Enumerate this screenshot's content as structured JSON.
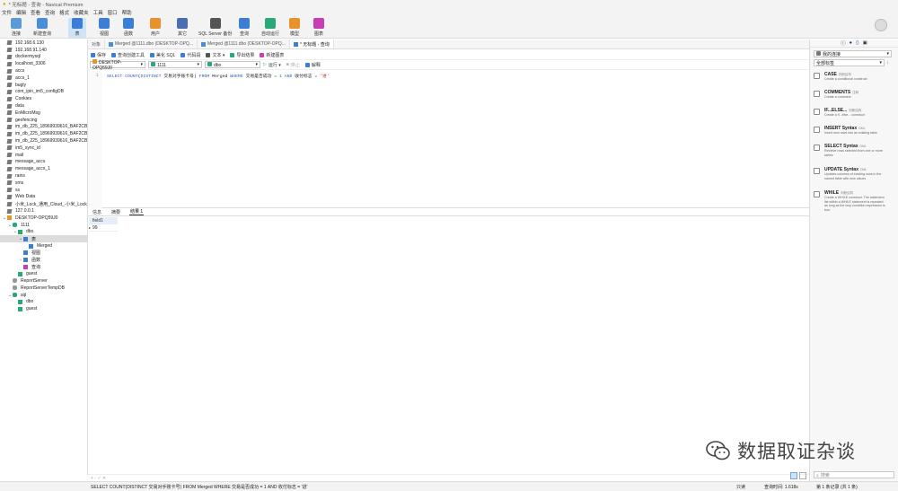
{
  "window": {
    "title": "* 无标题 - 查询 - Navicat Premium"
  },
  "menu": [
    "文件",
    "编辑",
    "查看",
    "查询",
    "格式",
    "收藏夹",
    "工具",
    "窗口",
    "帮助"
  ],
  "toolbar": [
    {
      "label": "连接",
      "icon": "connection-icon",
      "color": "#5b9bd5"
    },
    {
      "label": "新建查询",
      "icon": "new-query-icon",
      "color": "#4a8ed8"
    },
    {
      "label": "表",
      "icon": "table-icon",
      "color": "#3a7fd5",
      "active": true
    },
    {
      "label": "视图",
      "icon": "view-icon",
      "color": "#3a7fd5"
    },
    {
      "label": "函数",
      "icon": "function-icon",
      "color": "#3a7fd5"
    },
    {
      "label": "用户",
      "icon": "user-icon",
      "color": "#e8922c"
    },
    {
      "label": "其它",
      "icon": "other-icon",
      "color": "#4a6fb0"
    },
    {
      "label": "SQL Server 备份",
      "icon": "backup-icon",
      "color": "#555555"
    },
    {
      "label": "查询",
      "icon": "query-icon",
      "color": "#3a7fd5"
    },
    {
      "label": "自动运行",
      "icon": "automation-icon",
      "color": "#2aa876"
    },
    {
      "label": "模型",
      "icon": "model-icon",
      "color": "#e8922c"
    },
    {
      "label": "图表",
      "icon": "chart-icon",
      "color": "#c83fb5"
    }
  ],
  "nav": [
    {
      "label": "192.168.6.130",
      "icon": "db",
      "level": 0
    },
    {
      "label": "192.168.91.140",
      "icon": "db",
      "level": 0
    },
    {
      "label": "dockermysql",
      "icon": "db",
      "level": 0
    },
    {
      "label": "localhost_3306",
      "icon": "db",
      "level": 0
    },
    {
      "label": "accs",
      "icon": "db",
      "level": 0
    },
    {
      "label": "accs_1",
      "icon": "db",
      "level": 0
    },
    {
      "label": "bugly",
      "icon": "db",
      "level": 0
    },
    {
      "label": "com_ipin_im5_configDB",
      "icon": "db",
      "level": 0
    },
    {
      "label": "Cookies",
      "icon": "db",
      "level": 0
    },
    {
      "label": "data",
      "icon": "db",
      "level": 0
    },
    {
      "label": "EnMicroMsg",
      "icon": "db",
      "level": 0
    },
    {
      "label": "geofencing",
      "icon": "db",
      "level": 0
    },
    {
      "label": "im_db_225_18969939616_BAF2CB1F-",
      "icon": "db",
      "level": 0
    },
    {
      "label": "im_db_225_18969939616_BAF2CB1F-",
      "icon": "db",
      "level": 0
    },
    {
      "label": "im_db_225_18969939616_BAF2CB1F-",
      "icon": "db",
      "level": 0
    },
    {
      "label": "im5_sync_id",
      "icon": "db",
      "level": 0
    },
    {
      "label": "mail",
      "icon": "db",
      "level": 0
    },
    {
      "label": "message_accs",
      "icon": "db",
      "level": 0
    },
    {
      "label": "message_accs_1",
      "icon": "db",
      "level": 0
    },
    {
      "label": "rains",
      "icon": "db",
      "level": 0
    },
    {
      "label": "sms",
      "icon": "db",
      "level": 0
    },
    {
      "label": "ss",
      "icon": "db",
      "level": 0
    },
    {
      "label": "Web Data",
      "icon": "db",
      "level": 0
    },
    {
      "label": "小米_Lock_通用_Cloud_-小米_Lock_通",
      "icon": "db",
      "level": 0
    },
    {
      "label": "127.0.0.1",
      "icon": "db",
      "level": 0
    },
    {
      "label": "DESKTOP-OPQ59J0",
      "icon": "server",
      "level": 0,
      "toggle": "v"
    },
    {
      "label": "1111",
      "icon": "database",
      "level": 1,
      "toggle": "v"
    },
    {
      "label": "dbo",
      "icon": "schema",
      "level": 2,
      "toggle": "v"
    },
    {
      "label": "表",
      "icon": "table",
      "level": 3,
      "toggle": "v",
      "selected": true
    },
    {
      "label": "Merged",
      "icon": "table",
      "level": 4
    },
    {
      "label": "视图",
      "icon": "view",
      "level": 3
    },
    {
      "label": "函数",
      "icon": "function",
      "level": 3,
      "toggle": ">"
    },
    {
      "label": "查询",
      "icon": "query",
      "level": 3
    },
    {
      "label": "guest",
      "icon": "schema",
      "level": 2
    },
    {
      "label": "ReportServer",
      "icon": "database-grey",
      "level": 1
    },
    {
      "label": "ReportServerTempDB",
      "icon": "database-grey",
      "level": 1
    },
    {
      "label": "sql",
      "icon": "database",
      "level": 1,
      "toggle": "v"
    },
    {
      "label": "dbo",
      "icon": "schema",
      "level": 2
    },
    {
      "label": "guest",
      "icon": "schema",
      "level": 2
    }
  ],
  "tabs": [
    {
      "label": "对象",
      "active": false
    },
    {
      "label": "Merged @1111.dbo (DESKTOP-OPQ...",
      "active": false
    },
    {
      "label": "Merged @1111.dbo (DESKTOP-OPQ...",
      "active": false
    },
    {
      "label": "* 无标题 - 查询",
      "active": true
    }
  ],
  "query_toolbar": [
    {
      "label": "保存",
      "color": "#3a7fd5"
    },
    {
      "label": "查询创建工具",
      "color": "#3a7fd5"
    },
    {
      "label": "美化 SQL",
      "color": "#3a7fd5"
    },
    {
      "label": "代码段",
      "color": "#3a7fd5"
    },
    {
      "label": "文本 ▾",
      "color": "#555555"
    },
    {
      "label": "导出结果",
      "color": "#2aa876"
    },
    {
      "label": "新建图表",
      "color": "#c83fb5"
    }
  ],
  "query_select": {
    "server": "DESKTOP-OPQ59J0",
    "database": "1111",
    "schema": "dbo",
    "run": "运行 ▾",
    "stop": "停止",
    "explain": "解释"
  },
  "editor": {
    "line_number": "1",
    "sql_tokens": [
      {
        "t": "SELECT ",
        "c": "kw"
      },
      {
        "t": "COUNT",
        "c": "kw"
      },
      {
        "t": "(",
        "c": ""
      },
      {
        "t": "DISTINCT ",
        "c": "kw"
      },
      {
        "t": "交易对手账卡号",
        "c": ""
      },
      {
        "t": ") ",
        "c": ""
      },
      {
        "t": "FROM ",
        "c": "kw"
      },
      {
        "t": "Merged ",
        "c": ""
      },
      {
        "t": "WHERE ",
        "c": "kw"
      },
      {
        "t": "交易是否成功 ",
        "c": ""
      },
      {
        "t": "= ",
        "c": ""
      },
      {
        "t": "1 ",
        "c": "num"
      },
      {
        "t": "AND ",
        "c": "kw"
      },
      {
        "t": "收付标志 ",
        "c": ""
      },
      {
        "t": "= ",
        "c": ""
      },
      {
        "t": "'进'",
        "c": "str"
      }
    ]
  },
  "result_tabs": [
    {
      "label": "信息",
      "active": false
    },
    {
      "label": "摘要",
      "active": false
    },
    {
      "label": "结果 1",
      "active": true
    }
  ],
  "result_grid": {
    "header": "field1",
    "rows": [
      "99"
    ]
  },
  "bottom_controls": "+ - ✓ ✕",
  "status": {
    "sql": "SELECT COUNT(DISTINCT 交易对手账卡号) FROM Merged WHERE 交易是否成功 = 1 AND 收付标志 = '进'",
    "mode": "只读",
    "time": "查询时间: 1.618s",
    "records": "第 1 条记录 (共 1 条)"
  },
  "right_pane": {
    "tab_icons": [
      "info-icon",
      "ddl-icon",
      "code-icon",
      "table-icon"
    ],
    "snippet_scope": "我的连接",
    "snippet_filter": "全部标签",
    "search_placeholder": "搜索",
    "snippets": [
      {
        "title": "CASE",
        "tag": "判断结构",
        "desc": "Create a conditional construct"
      },
      {
        "title": "COMMENTS",
        "tag": "注释",
        "desc": "Create a comment"
      },
      {
        "title": "IF...ELSE...",
        "tag": "判断结构",
        "desc": "Create a if...else... construct"
      },
      {
        "title": "INSERT Syntax",
        "tag": "DML",
        "desc": "Insert new rows into an existing table"
      },
      {
        "title": "SELECT Syntax",
        "tag": "DML",
        "desc": "Retrieve rows selected from one or more tables"
      },
      {
        "title": "UPDATE Syntax",
        "tag": "DML",
        "desc": "Updates columns of existing rows in the named table with new values"
      },
      {
        "title": "WHILE",
        "tag": "判断结构",
        "desc": "Create a WHILE construct. The statement list within a WHILE statement is repeated as long as the loop condition expression is true."
      }
    ]
  },
  "watermark": "数据取证杂谈"
}
